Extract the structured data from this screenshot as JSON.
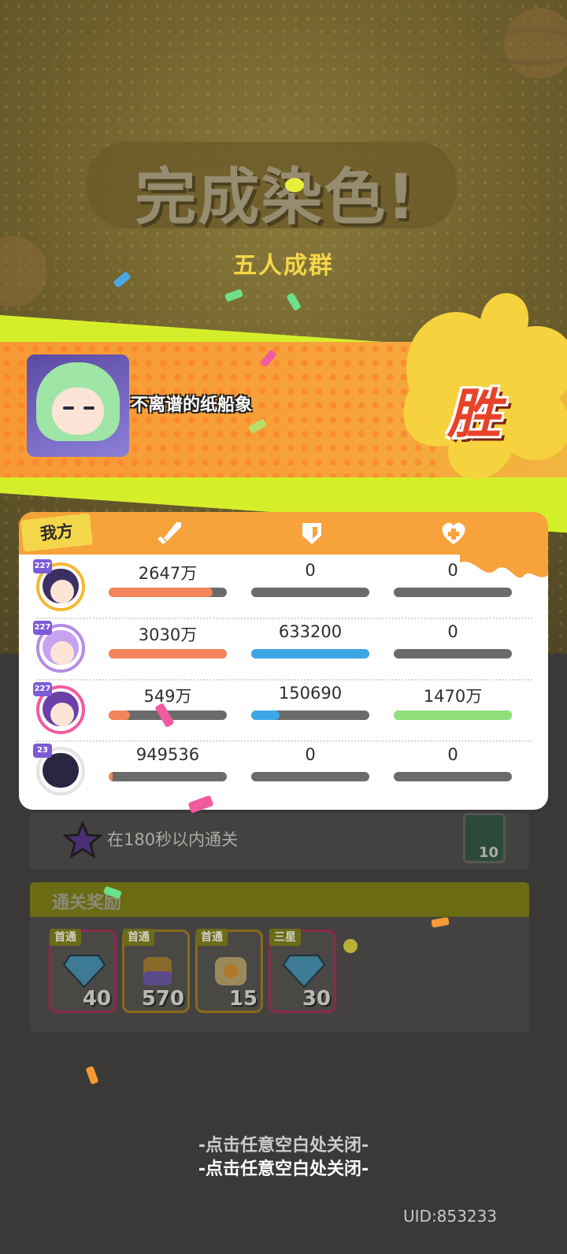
{
  "title": "完成染色!",
  "subtitle": "五人成群",
  "banner": {
    "player_name": "不离谱的纸船象",
    "result": "胜"
  },
  "panel": {
    "team_label": "我方",
    "icons": [
      "sword-icon",
      "shield-icon",
      "heart-plus-icon"
    ],
    "rows": [
      {
        "level": "227",
        "damage": "2647万",
        "damage_pct": 0.88,
        "defense": "0",
        "defense_pct": 0,
        "heal": "0",
        "heal_pct": 0
      },
      {
        "level": "227",
        "damage": "3030万",
        "damage_pct": 1.0,
        "defense": "633200",
        "defense_pct": 1.0,
        "heal": "0",
        "heal_pct": 0
      },
      {
        "level": "227",
        "damage": "549万",
        "damage_pct": 0.18,
        "defense": "150690",
        "defense_pct": 0.24,
        "heal": "1470万",
        "heal_pct": 1.0
      },
      {
        "level": "23",
        "damage": "949536",
        "damage_pct": 0.03,
        "defense": "0",
        "defense_pct": 0,
        "heal": "0",
        "heal_pct": 0
      }
    ]
  },
  "task": {
    "text": "在180秒以内通关",
    "count": "10"
  },
  "rewards": {
    "title": "通关奖励",
    "items": [
      {
        "tag": "首通",
        "qty": "40",
        "icon": "diamond-icon"
      },
      {
        "tag": "首通",
        "qty": "570",
        "icon": "paint-jar-icon"
      },
      {
        "tag": "首通",
        "qty": "15",
        "icon": "coin-jar-icon"
      },
      {
        "tag": "三星",
        "qty": "30",
        "icon": "diamond-icon"
      }
    ]
  },
  "close_hint": "-点击任意空白处关闭-",
  "uid": "UID:853233",
  "colors": {
    "banner": "#f7a23a",
    "lime": "#d4ef2a",
    "damage_bar": "#f4845a",
    "defense_bar": "#3fa6e6",
    "heal_bar": "#8fe07a",
    "win_text": "#e8432a"
  }
}
